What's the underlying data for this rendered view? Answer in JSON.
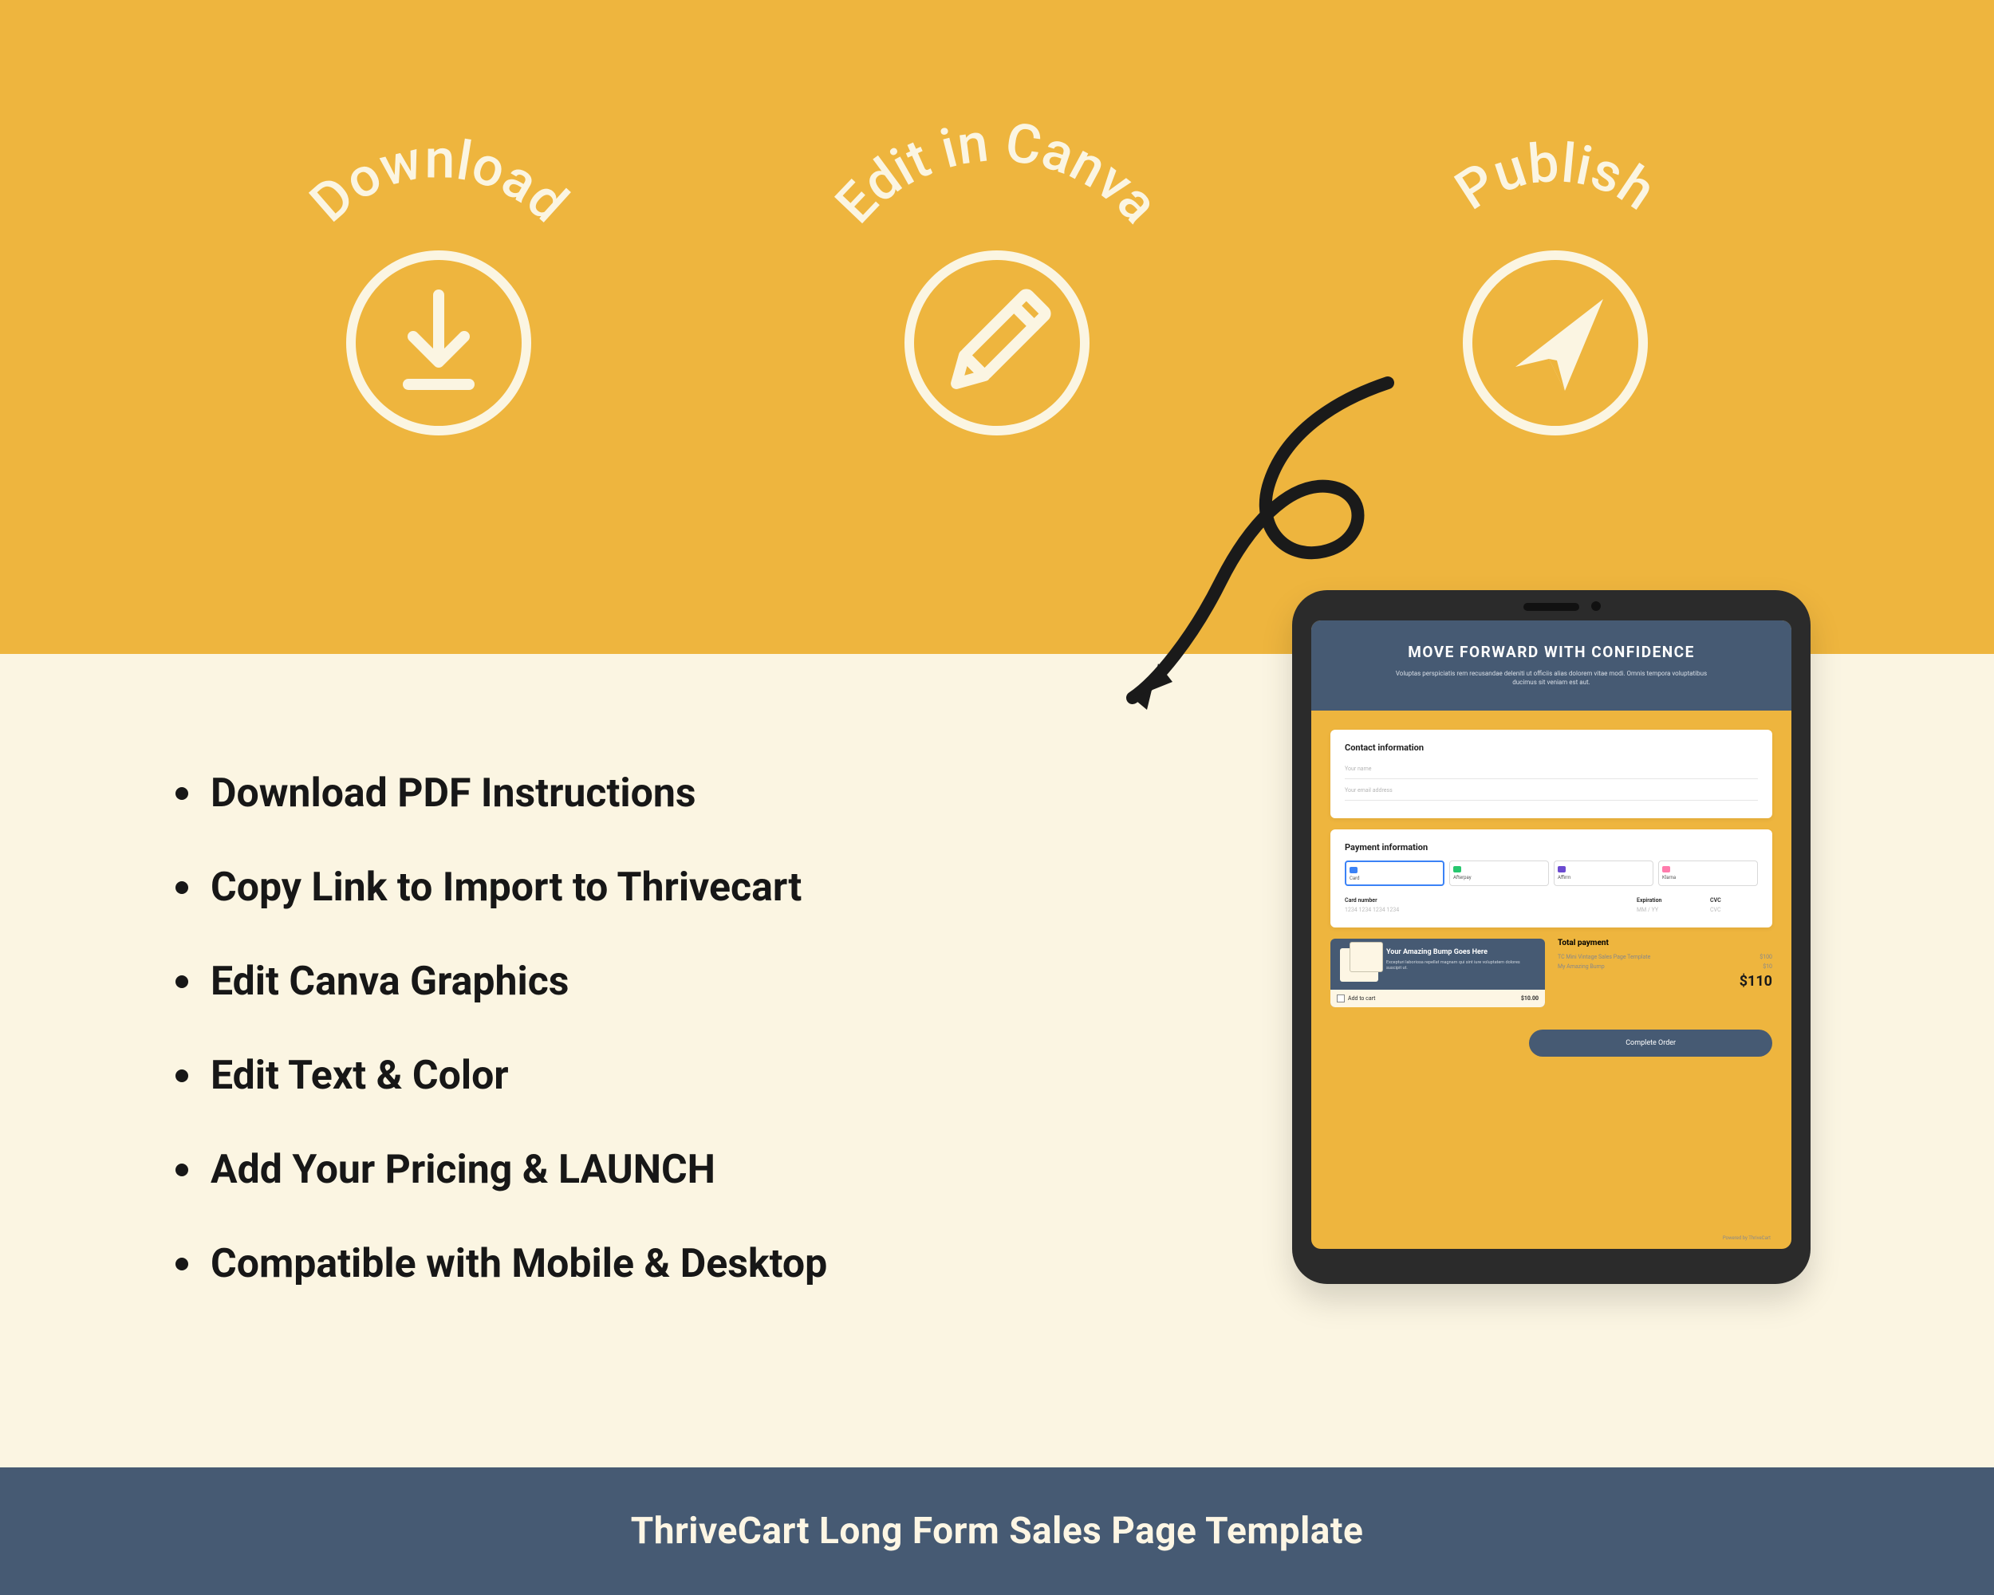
{
  "steps": [
    {
      "label": "Download"
    },
    {
      "label": "Edit in Canva"
    },
    {
      "label": "Publish"
    }
  ],
  "bullets": [
    "Download PDF Instructions",
    "Copy Link to Import to Thrivecart",
    "Edit Canva Graphics",
    "Edit Text & Color",
    "Add Your Pricing & LAUNCH",
    "Compatible with Mobile & Desktop"
  ],
  "footer": "ThriveCart Long Form Sales Page Template",
  "tablet": {
    "hero_title": "MOVE FORWARD WITH CONFIDENCE",
    "hero_sub": "Voluptas perspiciatis rem recusandae deleniti ut officiis alias dolorem vitae modi. Omnis tempora voluptatibus ducimus sit veniam est aut.",
    "contact": {
      "heading": "Contact information",
      "name_placeholder": "Your name",
      "email_placeholder": "Your email address"
    },
    "payment": {
      "heading": "Payment information",
      "tabs": [
        "Card",
        "Afterpay",
        "Affirm",
        "Klarna"
      ],
      "card_number_label": "Card number",
      "card_number_placeholder": "1234 1234 1234 1234",
      "exp_label": "Expiration",
      "exp_placeholder": "MM / YY",
      "cvc_label": "CVC",
      "cvc_placeholder": "CVC"
    },
    "bump": {
      "title": "Your Amazing Bump Goes Here",
      "desc": "Excepturi laboriosa repellat magnam qui sint iure voluptatem dolores suscipit ut.",
      "add_label": "Add to cart",
      "price": "$10.00"
    },
    "total": {
      "heading": "Total payment",
      "lines": [
        {
          "label": "TC Mini Vintage Sales Page Template",
          "amount": "$100"
        },
        {
          "label": "My Amazing Bump",
          "amount": "$10"
        }
      ],
      "sum": "$110"
    },
    "cta": "Complete Order",
    "powered": "Powered by ThriveCart"
  }
}
